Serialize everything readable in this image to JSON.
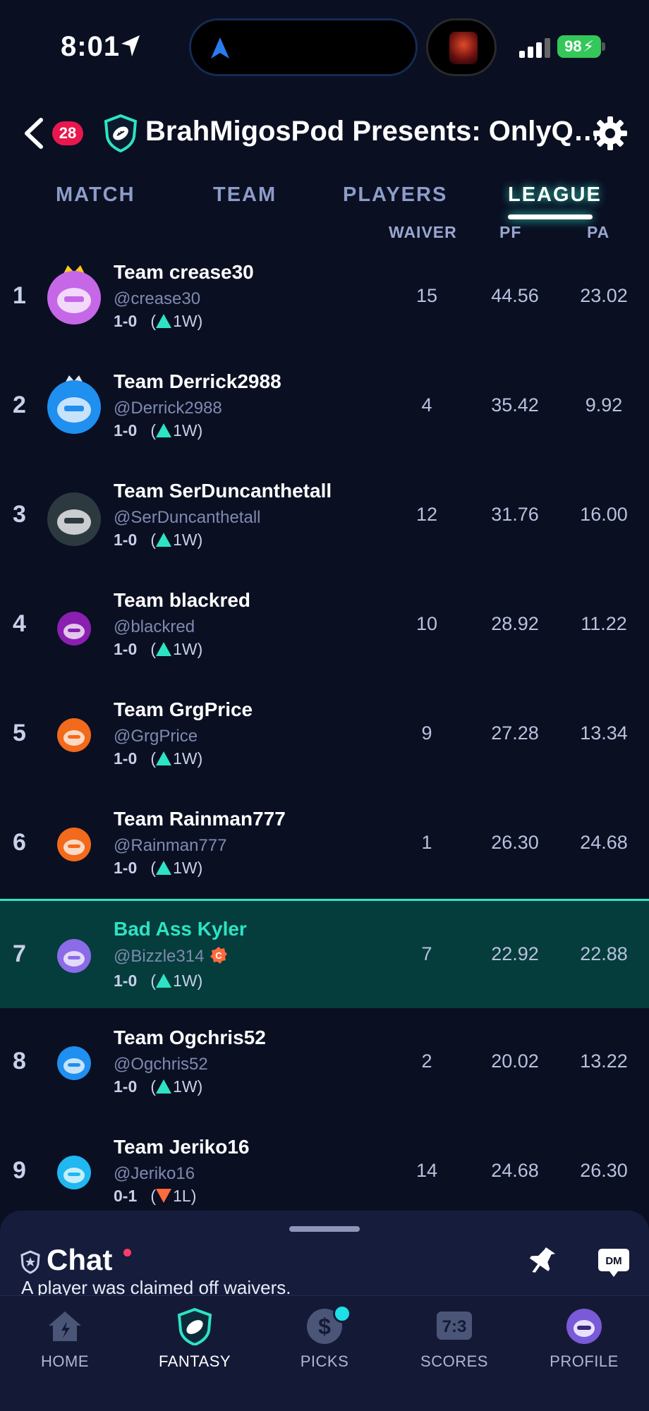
{
  "status_bar": {
    "time": "8:01",
    "battery": "98"
  },
  "header": {
    "notification_count": "28",
    "league_title": "BrahMigosPod Presents: OnlyQ…"
  },
  "tabs": [
    {
      "label": "MATCH"
    },
    {
      "label": "TEAM"
    },
    {
      "label": "PLAYERS"
    },
    {
      "label": "LEAGUE"
    }
  ],
  "columns": {
    "waiver": "WAIVER",
    "pf": "PF",
    "pa": "PA"
  },
  "standings": [
    {
      "rank": "1",
      "team": "Team crease30",
      "handle": "@crease30",
      "record": "1-0",
      "streak": "1W",
      "streak_dir": "up",
      "waiver": "15",
      "pf": "44.56",
      "pa": "23.02",
      "avatar_color": "#c667e8"
    },
    {
      "rank": "2",
      "team": "Team Derrick2988",
      "handle": "@Derrick2988",
      "record": "1-0",
      "streak": "1W",
      "streak_dir": "up",
      "waiver": "4",
      "pf": "35.42",
      "pa": "9.92",
      "avatar_color": "#1f8ff0"
    },
    {
      "rank": "3",
      "team": "Team SerDuncanthetall",
      "handle": "@SerDuncanthetall",
      "record": "1-0",
      "streak": "1W",
      "streak_dir": "up",
      "waiver": "12",
      "pf": "31.76",
      "pa": "16.00",
      "avatar_color": "#2c3a40"
    },
    {
      "rank": "4",
      "team": "Team blackred",
      "handle": "@blackred",
      "record": "1-0",
      "streak": "1W",
      "streak_dir": "up",
      "waiver": "10",
      "pf": "28.92",
      "pa": "11.22",
      "avatar_color": "#8a1fb0"
    },
    {
      "rank": "5",
      "team": "Team GrgPrice",
      "handle": "@GrgPrice",
      "record": "1-0",
      "streak": "1W",
      "streak_dir": "up",
      "waiver": "9",
      "pf": "27.28",
      "pa": "13.34",
      "avatar_color": "#f26a1b"
    },
    {
      "rank": "6",
      "team": "Team Rainman777",
      "handle": "@Rainman777",
      "record": "1-0",
      "streak": "1W",
      "streak_dir": "up",
      "waiver": "1",
      "pf": "26.30",
      "pa": "24.68",
      "avatar_color": "#f26a1b"
    },
    {
      "rank": "7",
      "team": "Bad Ass Kyler",
      "handle": "@Bizzle314",
      "record": "1-0",
      "streak": "1W",
      "streak_dir": "up",
      "waiver": "7",
      "pf": "22.92",
      "pa": "22.88",
      "avatar_color": "#8b6be8",
      "is_me": true,
      "captain_badge": "C"
    },
    {
      "rank": "8",
      "team": "Team Ogchris52",
      "handle": "@Ogchris52",
      "record": "1-0",
      "streak": "1W",
      "streak_dir": "up",
      "waiver": "2",
      "pf": "20.02",
      "pa": "13.22",
      "avatar_color": "#1f8ff0"
    },
    {
      "rank": "9",
      "team": "Team Jeriko16",
      "handle": "@Jeriko16",
      "record": "0-1",
      "streak": "1L",
      "streak_dir": "down",
      "waiver": "14",
      "pf": "24.68",
      "pa": "26.30",
      "avatar_color": "#1fb8f0"
    }
  ],
  "chat": {
    "title": "Chat",
    "message": "A player was claimed off waivers.",
    "dm_label": "DM"
  },
  "bottom_nav": [
    {
      "label": "HOME",
      "icon": "home-icon"
    },
    {
      "label": "FANTASY",
      "icon": "fantasy-shield-icon",
      "active": true
    },
    {
      "label": "PICKS",
      "icon": "picks-dollar-icon"
    },
    {
      "label": "SCORES",
      "icon": "scores-icon",
      "score_text": "7:3"
    },
    {
      "label": "PROFILE",
      "icon": "profile-avatar-icon"
    }
  ],
  "colors": {
    "accent": "#2de3c4",
    "background": "#0a0f22",
    "badge": "#e8184f",
    "loss": "#ff6a3d"
  }
}
